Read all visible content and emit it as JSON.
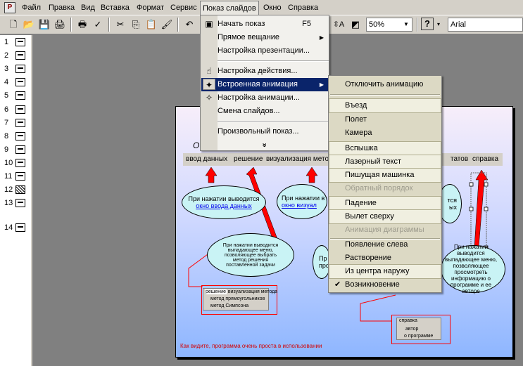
{
  "menubar": {
    "items": [
      "Файл",
      "Правка",
      "Вид",
      "Вставка",
      "Формат",
      "Сервис",
      "Показ слайдов",
      "Окно",
      "Справка"
    ],
    "open_item": "Показ слайдов"
  },
  "toolbar": {
    "zoom": "50%",
    "font": "Arial"
  },
  "outline": {
    "slides": [
      "1",
      "2",
      "3",
      "4",
      "5",
      "6",
      "7",
      "8",
      "9",
      "10",
      "11",
      "12",
      "13",
      "14"
    ]
  },
  "slideshow_menu": {
    "start_show": "Начать показ",
    "start_show_shortcut": "F5",
    "broadcast": "Прямое вещание",
    "setup_show": "Настройка презентации...",
    "action_settings": "Настройка действия...",
    "preset_animation": "Встроенная анимация",
    "custom_animation": "Настройка анимации...",
    "slide_transition": "Смена слайдов...",
    "custom_show": "Произвольный показ...",
    "more": "»"
  },
  "animation_menu": {
    "items": [
      {
        "label": "Отключить анимацию",
        "state": "normal"
      },
      {
        "label": "Въезд",
        "state": "highlight"
      },
      {
        "label": "Полет",
        "state": "normal"
      },
      {
        "label": "Камера",
        "state": "normal"
      },
      {
        "label": "Вспышка",
        "state": "highlight"
      },
      {
        "label": "Лазерный текст",
        "state": "highlight"
      },
      {
        "label": "Пишущая машинка",
        "state": "highlight"
      },
      {
        "label": "Обратный порядок",
        "state": "disabled"
      },
      {
        "label": "Падение",
        "state": "highlight"
      },
      {
        "label": "Вылет сверху",
        "state": "highlight"
      },
      {
        "label": "Анимация диаграммы",
        "state": "disabled"
      },
      {
        "label": "Появление слева",
        "state": "normal"
      },
      {
        "label": "Растворение",
        "state": "normal"
      },
      {
        "label": "Из центра наружу",
        "state": "highlight"
      },
      {
        "label": "Возникновение",
        "state": "checked"
      }
    ]
  },
  "slide": {
    "title_fragment": "е",
    "subtitle_fragment": "О",
    "nav_tabs": {
      "input": "ввод данных",
      "solution": "решение",
      "visualization": "визуализация метод",
      "results": "татов",
      "help": "справка"
    },
    "bubble1": {
      "line1": "При нажатии выводится",
      "link": "окно ввода данных"
    },
    "bubble2": {
      "line1": "При нажатии в",
      "link": "окно визуал"
    },
    "bubble3": {
      "text": "При нажатии выводится выпадающее меню, позволяющее выбрать метод решения поставленной задачи"
    },
    "bubble4": {
      "line1": "Пр",
      "line2": "прос"
    },
    "bubble5": {
      "line1": "тся",
      "line2": "ых"
    },
    "bubble6": {
      "text": "При нажатии выводится выпадающее меню, позволяющее просмотреть информацию о программе и ее авторе"
    },
    "mini_menu1": {
      "tab1": "решение",
      "tab2": "визуализация метода",
      "item1": "метод прямоугольников",
      "item2": "метод Симпсона"
    },
    "mini_menu2": {
      "tab": "справка",
      "item1": "автор",
      "item2": "о программе"
    },
    "footer": "Как видите, программа очень проста в использовании"
  }
}
